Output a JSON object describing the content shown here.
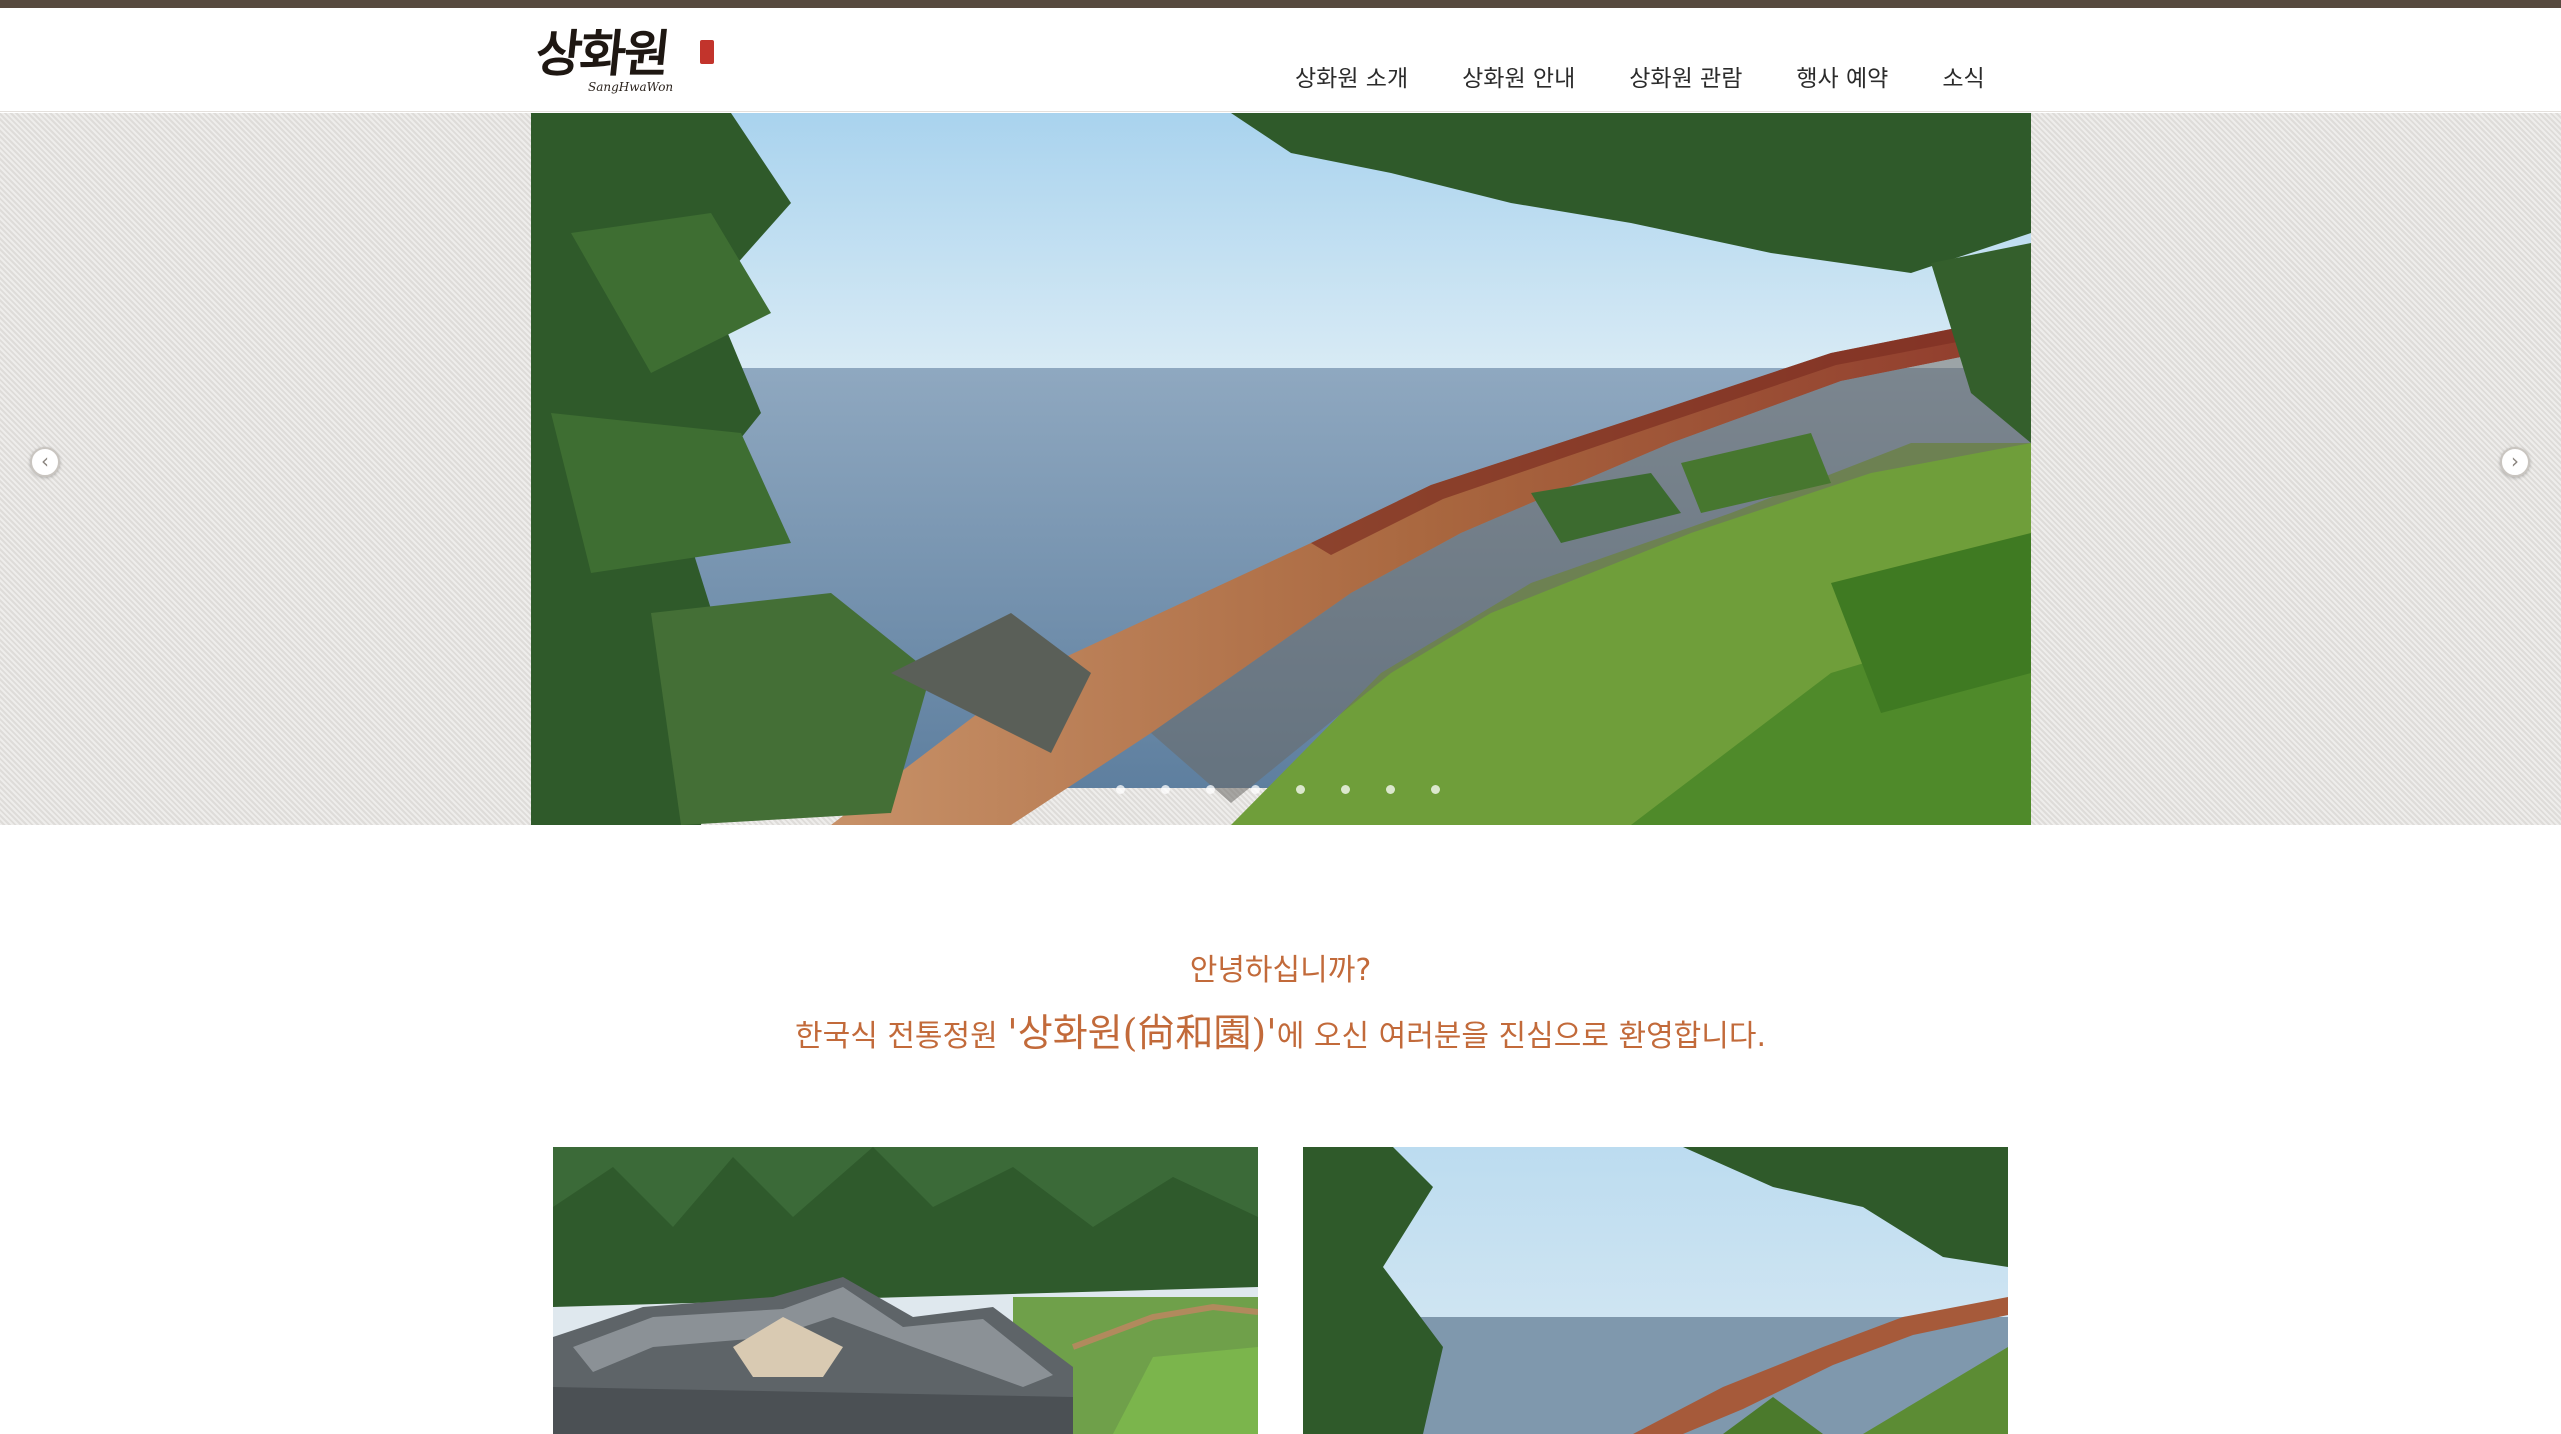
{
  "header": {
    "logo_text": "상화원",
    "logo_sub": "SangHwaWon",
    "nav": [
      "상화원 소개",
      "상화원 안내",
      "상화원 관람",
      "행사 예약",
      "소식"
    ]
  },
  "slider": {
    "prev_icon": "chevron-left-icon",
    "next_icon": "chevron-right-icon",
    "dot_count": 8,
    "active_dot": 4
  },
  "welcome": {
    "line1": "안녕하십니까?",
    "line2_before": "한국식 전통정원 ",
    "line2_name": "'상화원(尙和園)'",
    "line2_after": "에 오신 여러분을 진심으로 환영합니다."
  },
  "colors": {
    "topbar": "#574a3f",
    "accent_text": "#c26a3a",
    "pattern_bg": "#e5e3e0"
  }
}
